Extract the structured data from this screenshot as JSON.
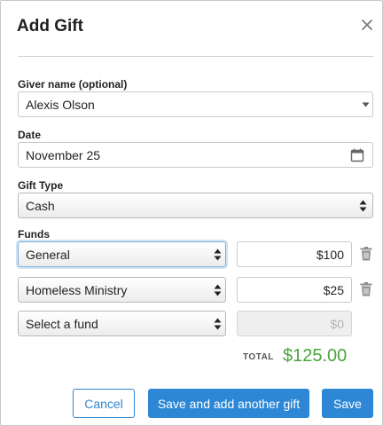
{
  "dialog": {
    "title": "Add Gift"
  },
  "giver": {
    "label": "Giver name (optional)",
    "value": "Alexis Olson"
  },
  "date": {
    "label": "Date",
    "value": "November 25"
  },
  "gift_type": {
    "label": "Gift Type",
    "value": "Cash"
  },
  "funds": {
    "label": "Funds",
    "rows": [
      {
        "fund": "General",
        "amount": "$100"
      },
      {
        "fund": "Homeless Ministry",
        "amount": "$25"
      },
      {
        "fund": "Select a fund",
        "amount_placeholder": "$0"
      }
    ]
  },
  "total": {
    "label": "TOTAL",
    "value": "$125.00",
    "color": "#4aa43b"
  },
  "actions": {
    "cancel": "Cancel",
    "save_another": "Save and add another gift",
    "save": "Save"
  },
  "colors": {
    "primary": "#2d87d5",
    "total_green": "#4aa43b",
    "focus_border": "#7fb2dd"
  },
  "icons": {
    "close": "close-icon",
    "calendar": "calendar-icon",
    "caret": "caret-down-icon",
    "sort": "sort-arrows-icon",
    "trash": "trash-icon"
  }
}
